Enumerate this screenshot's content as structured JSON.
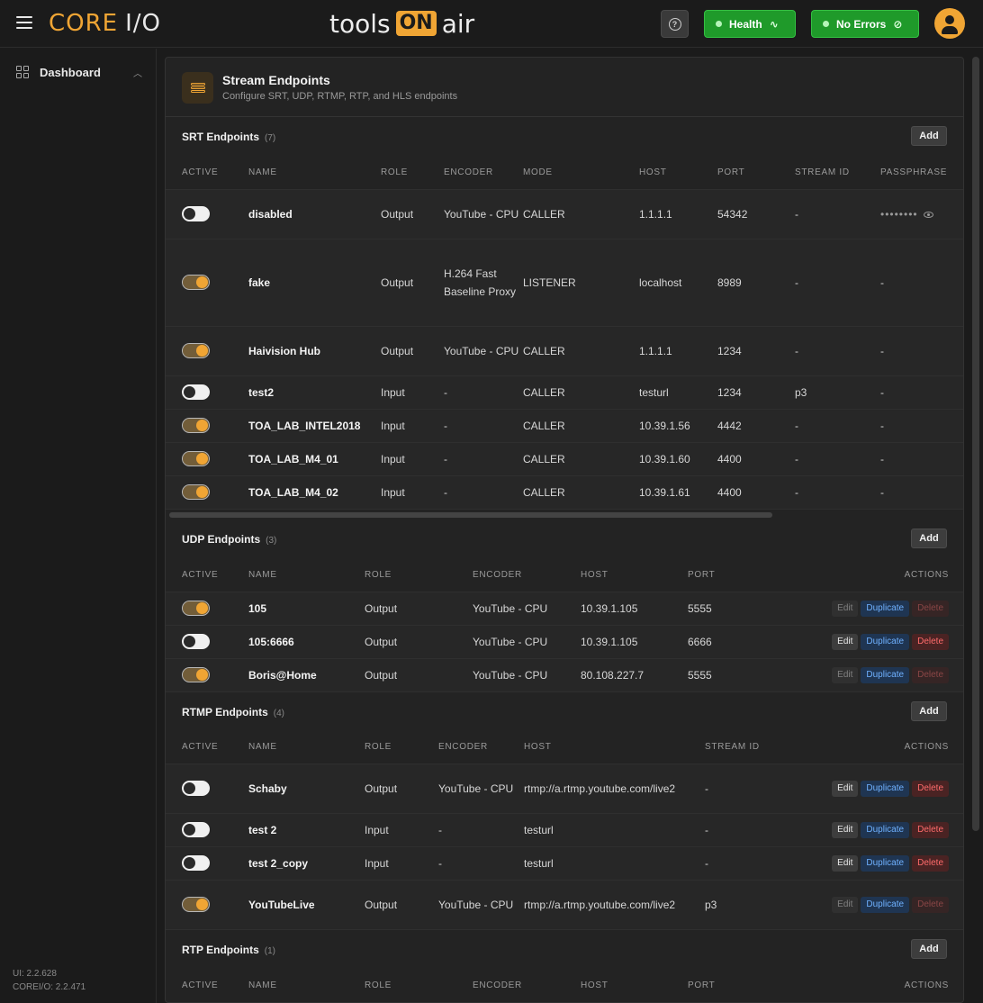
{
  "header": {
    "brand_core": "CORE",
    "brand_io": "I/O",
    "toa_left": "tools",
    "toa_on": "ON",
    "toa_right": "air",
    "health_label": "Health",
    "errors_label": "No Errors"
  },
  "sidebar": {
    "items": [
      {
        "label": "Dashboard"
      }
    ],
    "ui_version": "UI: 2.2.628",
    "core_version": "COREI/O: 2.2.471"
  },
  "page": {
    "title": "Stream Endpoints",
    "subtitle": "Configure SRT, UDP, RTMP, RTP, and HLS endpoints"
  },
  "srt": {
    "title": "SRT Endpoints",
    "count": "(7)",
    "add_label": "Add",
    "columns": [
      "ACTIVE",
      "NAME",
      "ROLE",
      "ENCODER",
      "MODE",
      "HOST",
      "PORT",
      "STREAM ID",
      "PASSPHRASE"
    ],
    "rows": [
      {
        "active": false,
        "name": "disabled",
        "role": "Output",
        "encoder": "YouTube - CPU",
        "mode": "CALLER",
        "host": "1.1.1.1",
        "port": "54342",
        "stream_id": "-",
        "passphrase": "••••••••"
      },
      {
        "active": true,
        "name": "fake",
        "role": "Output",
        "encoder": "H.264 Fast Baseline Proxy",
        "mode": "LISTENER",
        "host": "localhost",
        "port": "8989",
        "stream_id": "-",
        "passphrase": "-"
      },
      {
        "active": true,
        "name": "Haivision Hub",
        "role": "Output",
        "encoder": "YouTube - CPU",
        "mode": "CALLER",
        "host": "1.1.1.1",
        "port": "1234",
        "stream_id": "-",
        "passphrase": "-"
      },
      {
        "active": false,
        "name": "test2",
        "role": "Input",
        "encoder": "-",
        "mode": "CALLER",
        "host": "testurl",
        "port": "1234",
        "stream_id": "p3",
        "passphrase": "-"
      },
      {
        "active": true,
        "name": "TOA_LAB_INTEL2018",
        "role": "Input",
        "encoder": "-",
        "mode": "CALLER",
        "host": "10.39.1.56",
        "port": "4442",
        "stream_id": "-",
        "passphrase": "-"
      },
      {
        "active": true,
        "name": "TOA_LAB_M4_01",
        "role": "Input",
        "encoder": "-",
        "mode": "CALLER",
        "host": "10.39.1.60",
        "port": "4400",
        "stream_id": "-",
        "passphrase": "-"
      },
      {
        "active": true,
        "name": "TOA_LAB_M4_02",
        "role": "Input",
        "encoder": "-",
        "mode": "CALLER",
        "host": "10.39.1.61",
        "port": "4400",
        "stream_id": "-",
        "passphrase": "-"
      }
    ]
  },
  "udp": {
    "title": "UDP Endpoints",
    "count": "(3)",
    "add_label": "Add",
    "columns": [
      "ACTIVE",
      "NAME",
      "ROLE",
      "ENCODER",
      "HOST",
      "PORT",
      "ACTIONS"
    ],
    "rows": [
      {
        "active": true,
        "name": "105",
        "role": "Output",
        "encoder": "YouTube - CPU",
        "host": "10.39.1.105",
        "port": "5555",
        "can_modify": false
      },
      {
        "active": false,
        "name": "105:6666",
        "role": "Output",
        "encoder": "YouTube - CPU",
        "host": "10.39.1.105",
        "port": "6666",
        "can_modify": true
      },
      {
        "active": true,
        "name": "Boris@Home",
        "role": "Output",
        "encoder": "YouTube - CPU",
        "host": "80.108.227.7",
        "port": "5555",
        "can_modify": false
      }
    ]
  },
  "rtmp": {
    "title": "RTMP Endpoints",
    "count": "(4)",
    "add_label": "Add",
    "columns": [
      "ACTIVE",
      "NAME",
      "ROLE",
      "ENCODER",
      "HOST",
      "STREAM ID",
      "ACTIONS"
    ],
    "rows": [
      {
        "active": false,
        "name": "Schaby",
        "role": "Output",
        "encoder": "YouTube - CPU",
        "host": "rtmp://a.rtmp.youtube.com/live2",
        "stream_id": "-",
        "can_modify": true
      },
      {
        "active": false,
        "name": "test 2",
        "role": "Input",
        "encoder": "-",
        "host": "testurl",
        "stream_id": "-",
        "can_modify": true
      },
      {
        "active": false,
        "name": "test 2_copy",
        "role": "Input",
        "encoder": "-",
        "host": "testurl",
        "stream_id": "-",
        "can_modify": true
      },
      {
        "active": true,
        "name": "YouTubeLive",
        "role": "Output",
        "encoder": "YouTube - CPU",
        "host": "rtmp://a.rtmp.youtube.com/live2",
        "stream_id": "p3",
        "can_modify": false
      }
    ]
  },
  "rtp": {
    "title": "RTP Endpoints",
    "count": "(1)",
    "add_label": "Add",
    "columns": [
      "ACTIVE",
      "NAME",
      "ROLE",
      "ENCODER",
      "HOST",
      "PORT",
      "ACTIONS"
    ]
  },
  "actions": {
    "edit_label": "Edit",
    "duplicate_label": "Duplicate",
    "delete_label": "Delete"
  },
  "colors": {
    "accent": "#f0a534",
    "health_green": "#1f9a2a",
    "duplicate_blue": "#6fb1ff",
    "delete_red": "#ff6b6b"
  }
}
